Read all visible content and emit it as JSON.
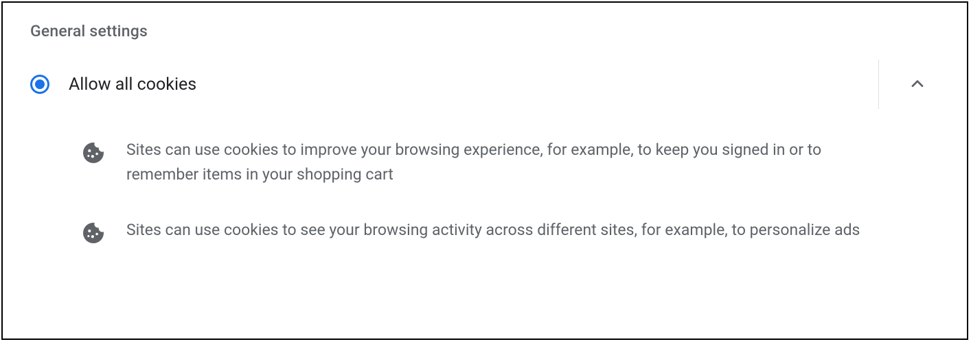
{
  "section": {
    "title": "General settings"
  },
  "option": {
    "label": "Allow all cookies",
    "selected": true,
    "expanded": true,
    "descriptions": [
      "Sites can use cookies to improve your browsing experience, for example, to keep you signed in or to remember items in your shopping cart",
      "Sites can use cookies to see your browsing activity across different sites, for example, to personalize ads"
    ]
  }
}
